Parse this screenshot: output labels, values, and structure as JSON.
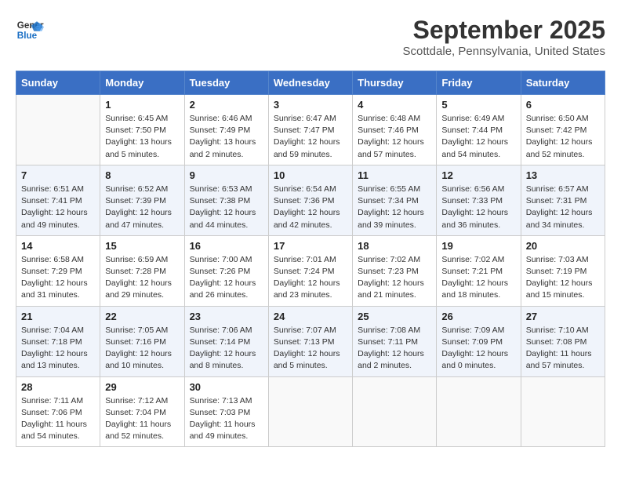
{
  "header": {
    "logo_line1": "General",
    "logo_line2": "Blue",
    "month_title": "September 2025",
    "location": "Scottdale, Pennsylvania, United States"
  },
  "weekdays": [
    "Sunday",
    "Monday",
    "Tuesday",
    "Wednesday",
    "Thursday",
    "Friday",
    "Saturday"
  ],
  "weeks": [
    [
      {
        "day": "",
        "sunrise": "",
        "sunset": "",
        "daylight": ""
      },
      {
        "day": "1",
        "sunrise": "Sunrise: 6:45 AM",
        "sunset": "Sunset: 7:50 PM",
        "daylight": "Daylight: 13 hours and 5 minutes."
      },
      {
        "day": "2",
        "sunrise": "Sunrise: 6:46 AM",
        "sunset": "Sunset: 7:49 PM",
        "daylight": "Daylight: 13 hours and 2 minutes."
      },
      {
        "day": "3",
        "sunrise": "Sunrise: 6:47 AM",
        "sunset": "Sunset: 7:47 PM",
        "daylight": "Daylight: 12 hours and 59 minutes."
      },
      {
        "day": "4",
        "sunrise": "Sunrise: 6:48 AM",
        "sunset": "Sunset: 7:46 PM",
        "daylight": "Daylight: 12 hours and 57 minutes."
      },
      {
        "day": "5",
        "sunrise": "Sunrise: 6:49 AM",
        "sunset": "Sunset: 7:44 PM",
        "daylight": "Daylight: 12 hours and 54 minutes."
      },
      {
        "day": "6",
        "sunrise": "Sunrise: 6:50 AM",
        "sunset": "Sunset: 7:42 PM",
        "daylight": "Daylight: 12 hours and 52 minutes."
      }
    ],
    [
      {
        "day": "7",
        "sunrise": "Sunrise: 6:51 AM",
        "sunset": "Sunset: 7:41 PM",
        "daylight": "Daylight: 12 hours and 49 minutes."
      },
      {
        "day": "8",
        "sunrise": "Sunrise: 6:52 AM",
        "sunset": "Sunset: 7:39 PM",
        "daylight": "Daylight: 12 hours and 47 minutes."
      },
      {
        "day": "9",
        "sunrise": "Sunrise: 6:53 AM",
        "sunset": "Sunset: 7:38 PM",
        "daylight": "Daylight: 12 hours and 44 minutes."
      },
      {
        "day": "10",
        "sunrise": "Sunrise: 6:54 AM",
        "sunset": "Sunset: 7:36 PM",
        "daylight": "Daylight: 12 hours and 42 minutes."
      },
      {
        "day": "11",
        "sunrise": "Sunrise: 6:55 AM",
        "sunset": "Sunset: 7:34 PM",
        "daylight": "Daylight: 12 hours and 39 minutes."
      },
      {
        "day": "12",
        "sunrise": "Sunrise: 6:56 AM",
        "sunset": "Sunset: 7:33 PM",
        "daylight": "Daylight: 12 hours and 36 minutes."
      },
      {
        "day": "13",
        "sunrise": "Sunrise: 6:57 AM",
        "sunset": "Sunset: 7:31 PM",
        "daylight": "Daylight: 12 hours and 34 minutes."
      }
    ],
    [
      {
        "day": "14",
        "sunrise": "Sunrise: 6:58 AM",
        "sunset": "Sunset: 7:29 PM",
        "daylight": "Daylight: 12 hours and 31 minutes."
      },
      {
        "day": "15",
        "sunrise": "Sunrise: 6:59 AM",
        "sunset": "Sunset: 7:28 PM",
        "daylight": "Daylight: 12 hours and 29 minutes."
      },
      {
        "day": "16",
        "sunrise": "Sunrise: 7:00 AM",
        "sunset": "Sunset: 7:26 PM",
        "daylight": "Daylight: 12 hours and 26 minutes."
      },
      {
        "day": "17",
        "sunrise": "Sunrise: 7:01 AM",
        "sunset": "Sunset: 7:24 PM",
        "daylight": "Daylight: 12 hours and 23 minutes."
      },
      {
        "day": "18",
        "sunrise": "Sunrise: 7:02 AM",
        "sunset": "Sunset: 7:23 PM",
        "daylight": "Daylight: 12 hours and 21 minutes."
      },
      {
        "day": "19",
        "sunrise": "Sunrise: 7:02 AM",
        "sunset": "Sunset: 7:21 PM",
        "daylight": "Daylight: 12 hours and 18 minutes."
      },
      {
        "day": "20",
        "sunrise": "Sunrise: 7:03 AM",
        "sunset": "Sunset: 7:19 PM",
        "daylight": "Daylight: 12 hours and 15 minutes."
      }
    ],
    [
      {
        "day": "21",
        "sunrise": "Sunrise: 7:04 AM",
        "sunset": "Sunset: 7:18 PM",
        "daylight": "Daylight: 12 hours and 13 minutes."
      },
      {
        "day": "22",
        "sunrise": "Sunrise: 7:05 AM",
        "sunset": "Sunset: 7:16 PM",
        "daylight": "Daylight: 12 hours and 10 minutes."
      },
      {
        "day": "23",
        "sunrise": "Sunrise: 7:06 AM",
        "sunset": "Sunset: 7:14 PM",
        "daylight": "Daylight: 12 hours and 8 minutes."
      },
      {
        "day": "24",
        "sunrise": "Sunrise: 7:07 AM",
        "sunset": "Sunset: 7:13 PM",
        "daylight": "Daylight: 12 hours and 5 minutes."
      },
      {
        "day": "25",
        "sunrise": "Sunrise: 7:08 AM",
        "sunset": "Sunset: 7:11 PM",
        "daylight": "Daylight: 12 hours and 2 minutes."
      },
      {
        "day": "26",
        "sunrise": "Sunrise: 7:09 AM",
        "sunset": "Sunset: 7:09 PM",
        "daylight": "Daylight: 12 hours and 0 minutes."
      },
      {
        "day": "27",
        "sunrise": "Sunrise: 7:10 AM",
        "sunset": "Sunset: 7:08 PM",
        "daylight": "Daylight: 11 hours and 57 minutes."
      }
    ],
    [
      {
        "day": "28",
        "sunrise": "Sunrise: 7:11 AM",
        "sunset": "Sunset: 7:06 PM",
        "daylight": "Daylight: 11 hours and 54 minutes."
      },
      {
        "day": "29",
        "sunrise": "Sunrise: 7:12 AM",
        "sunset": "Sunset: 7:04 PM",
        "daylight": "Daylight: 11 hours and 52 minutes."
      },
      {
        "day": "30",
        "sunrise": "Sunrise: 7:13 AM",
        "sunset": "Sunset: 7:03 PM",
        "daylight": "Daylight: 11 hours and 49 minutes."
      },
      {
        "day": "",
        "sunrise": "",
        "sunset": "",
        "daylight": ""
      },
      {
        "day": "",
        "sunrise": "",
        "sunset": "",
        "daylight": ""
      },
      {
        "day": "",
        "sunrise": "",
        "sunset": "",
        "daylight": ""
      },
      {
        "day": "",
        "sunrise": "",
        "sunset": "",
        "daylight": ""
      }
    ]
  ]
}
